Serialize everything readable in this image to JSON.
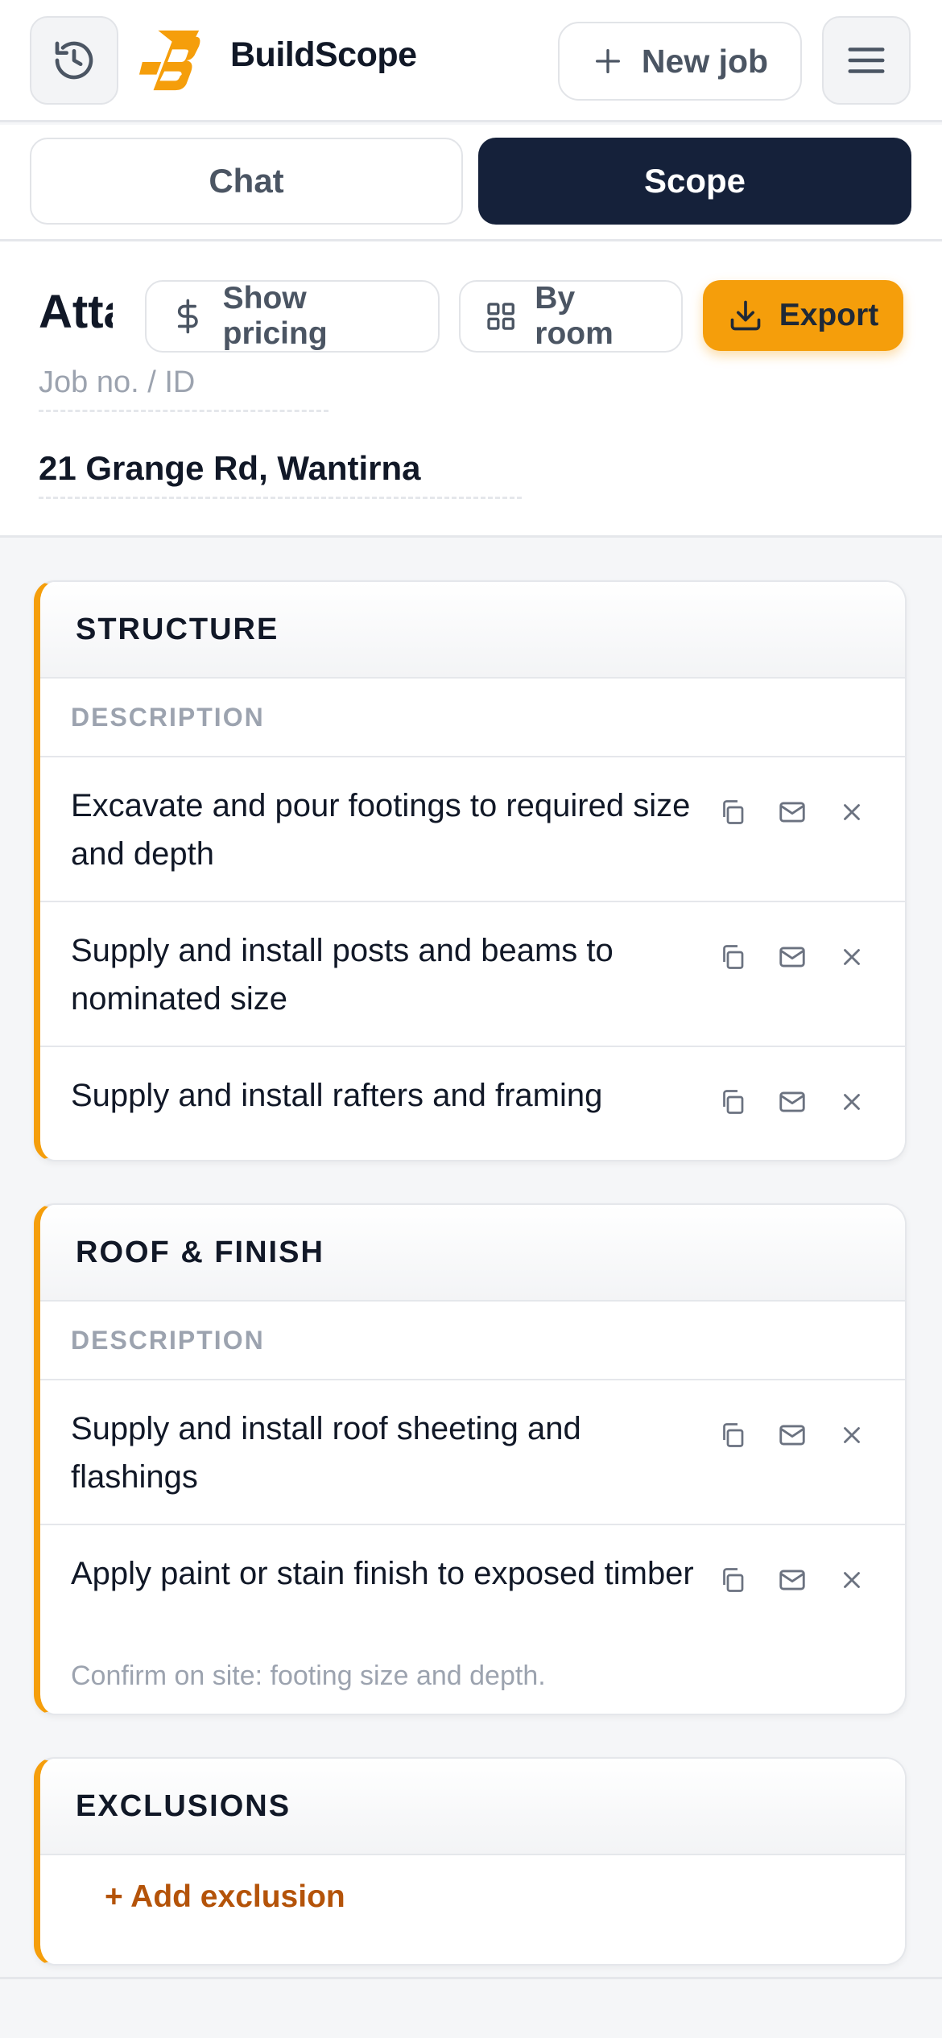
{
  "header": {
    "brand": "BuildScope",
    "new_job_label": "New job",
    "brand_color": "#F59E0B"
  },
  "tabs": [
    {
      "label": "Chat",
      "active": false
    },
    {
      "label": "Scope",
      "active": true
    }
  ],
  "job": {
    "title": "Atta",
    "id_placeholder": "Job no. / ID",
    "address": "21 Grange Rd, Wantirna",
    "actions": {
      "pricing_label": "Show pricing",
      "room_label": "By room",
      "export_label": "Export"
    }
  },
  "sections": [
    {
      "title": "STRUCTURE",
      "column_header": "DESCRIPTION",
      "items": [
        {
          "text": "Excavate and pour footings to required size and depth"
        },
        {
          "text": "Supply and install posts and beams to nominated size"
        },
        {
          "text": "Supply and install rafters and framing"
        }
      ]
    },
    {
      "title": "ROOF & FINISH",
      "column_header": "DESCRIPTION",
      "items": [
        {
          "text": "Supply and install roof sheeting and flashings"
        },
        {
          "text": "Apply paint or stain finish to exposed timber",
          "note": "Confirm on site: footing size and depth."
        }
      ]
    },
    {
      "title": "EXCLUSIONS",
      "add_label": "+ Add exclusion"
    }
  ],
  "icons": {
    "history": "history-icon",
    "menu": "menu-icon",
    "plus": "plus-icon",
    "dollar": "dollar-icon",
    "grid": "grid-icon",
    "download": "download-icon",
    "copy": "copy-icon",
    "mail": "mail-icon",
    "close": "close-icon"
  }
}
